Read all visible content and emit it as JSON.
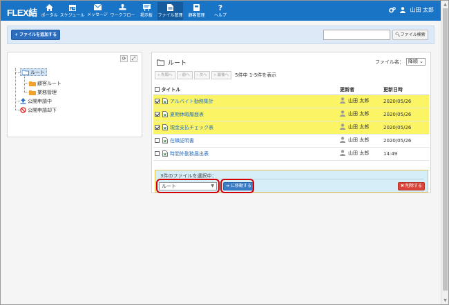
{
  "app": {
    "title": "FLEX結"
  },
  "nav": [
    {
      "label": "ポータル",
      "icon": "home-icon"
    },
    {
      "label": "スケジュール",
      "icon": "calendar-icon"
    },
    {
      "label": "メッセージ",
      "icon": "mail-icon"
    },
    {
      "label": "ワークフロー",
      "icon": "stamp-icon"
    },
    {
      "label": "掲示板",
      "icon": "board-icon"
    },
    {
      "label": "ファイル管理",
      "icon": "file-icon"
    },
    {
      "label": "顧客管理",
      "icon": "book-icon"
    },
    {
      "label": "ヘルプ",
      "icon": "help-icon"
    }
  ],
  "user": {
    "name": "山田 太郎"
  },
  "toolbar": {
    "add_file_label": "ファイルを追加する",
    "search_placeholder": "",
    "search_button_label": "ファイル検索"
  },
  "tree": {
    "root": "ルート",
    "children": [
      "顧客ルート",
      "業務管理"
    ],
    "publishing": "公開申請中",
    "rejected": "公開申請却下"
  },
  "folder": {
    "name": "ルート",
    "sort_label": "ファイル名：",
    "sort_value": "降順"
  },
  "pager": {
    "first": "« 先頭へ",
    "prev": "‹ 前へ",
    "next": "› 次へ",
    "last": "» 最後へ",
    "summary": "5件中 1-5件を表示"
  },
  "table": {
    "headers": {
      "title": "タイトル",
      "updater": "更新者",
      "updated_at": "更新日時"
    },
    "rows": [
      {
        "title": "アルバイト勤務集計",
        "updater": "山田 太郎",
        "date": "2020/05/26",
        "selected": true
      },
      {
        "title": "夏期休暇履歴表",
        "updater": "山田 太郎",
        "date": "2020/05/26",
        "selected": true
      },
      {
        "title": "現金支払チェック表",
        "updater": "山田 太郎",
        "date": "2020/05/26",
        "selected": true
      },
      {
        "title": "在職証明書",
        "updater": "山田 太郎",
        "date": "2020/05/26",
        "selected": false
      },
      {
        "title": "時間外勤務届出表",
        "updater": "山田 太郎",
        "date": "14:49",
        "selected": false
      }
    ]
  },
  "selection": {
    "label": "3件のファイルを選択中：",
    "destination": "ルート",
    "move_label": "に移動する",
    "delete_label": "削除する"
  },
  "colors": {
    "header": "#1a74c5",
    "highlight": "#fbf566",
    "annotation": "#d40000"
  }
}
